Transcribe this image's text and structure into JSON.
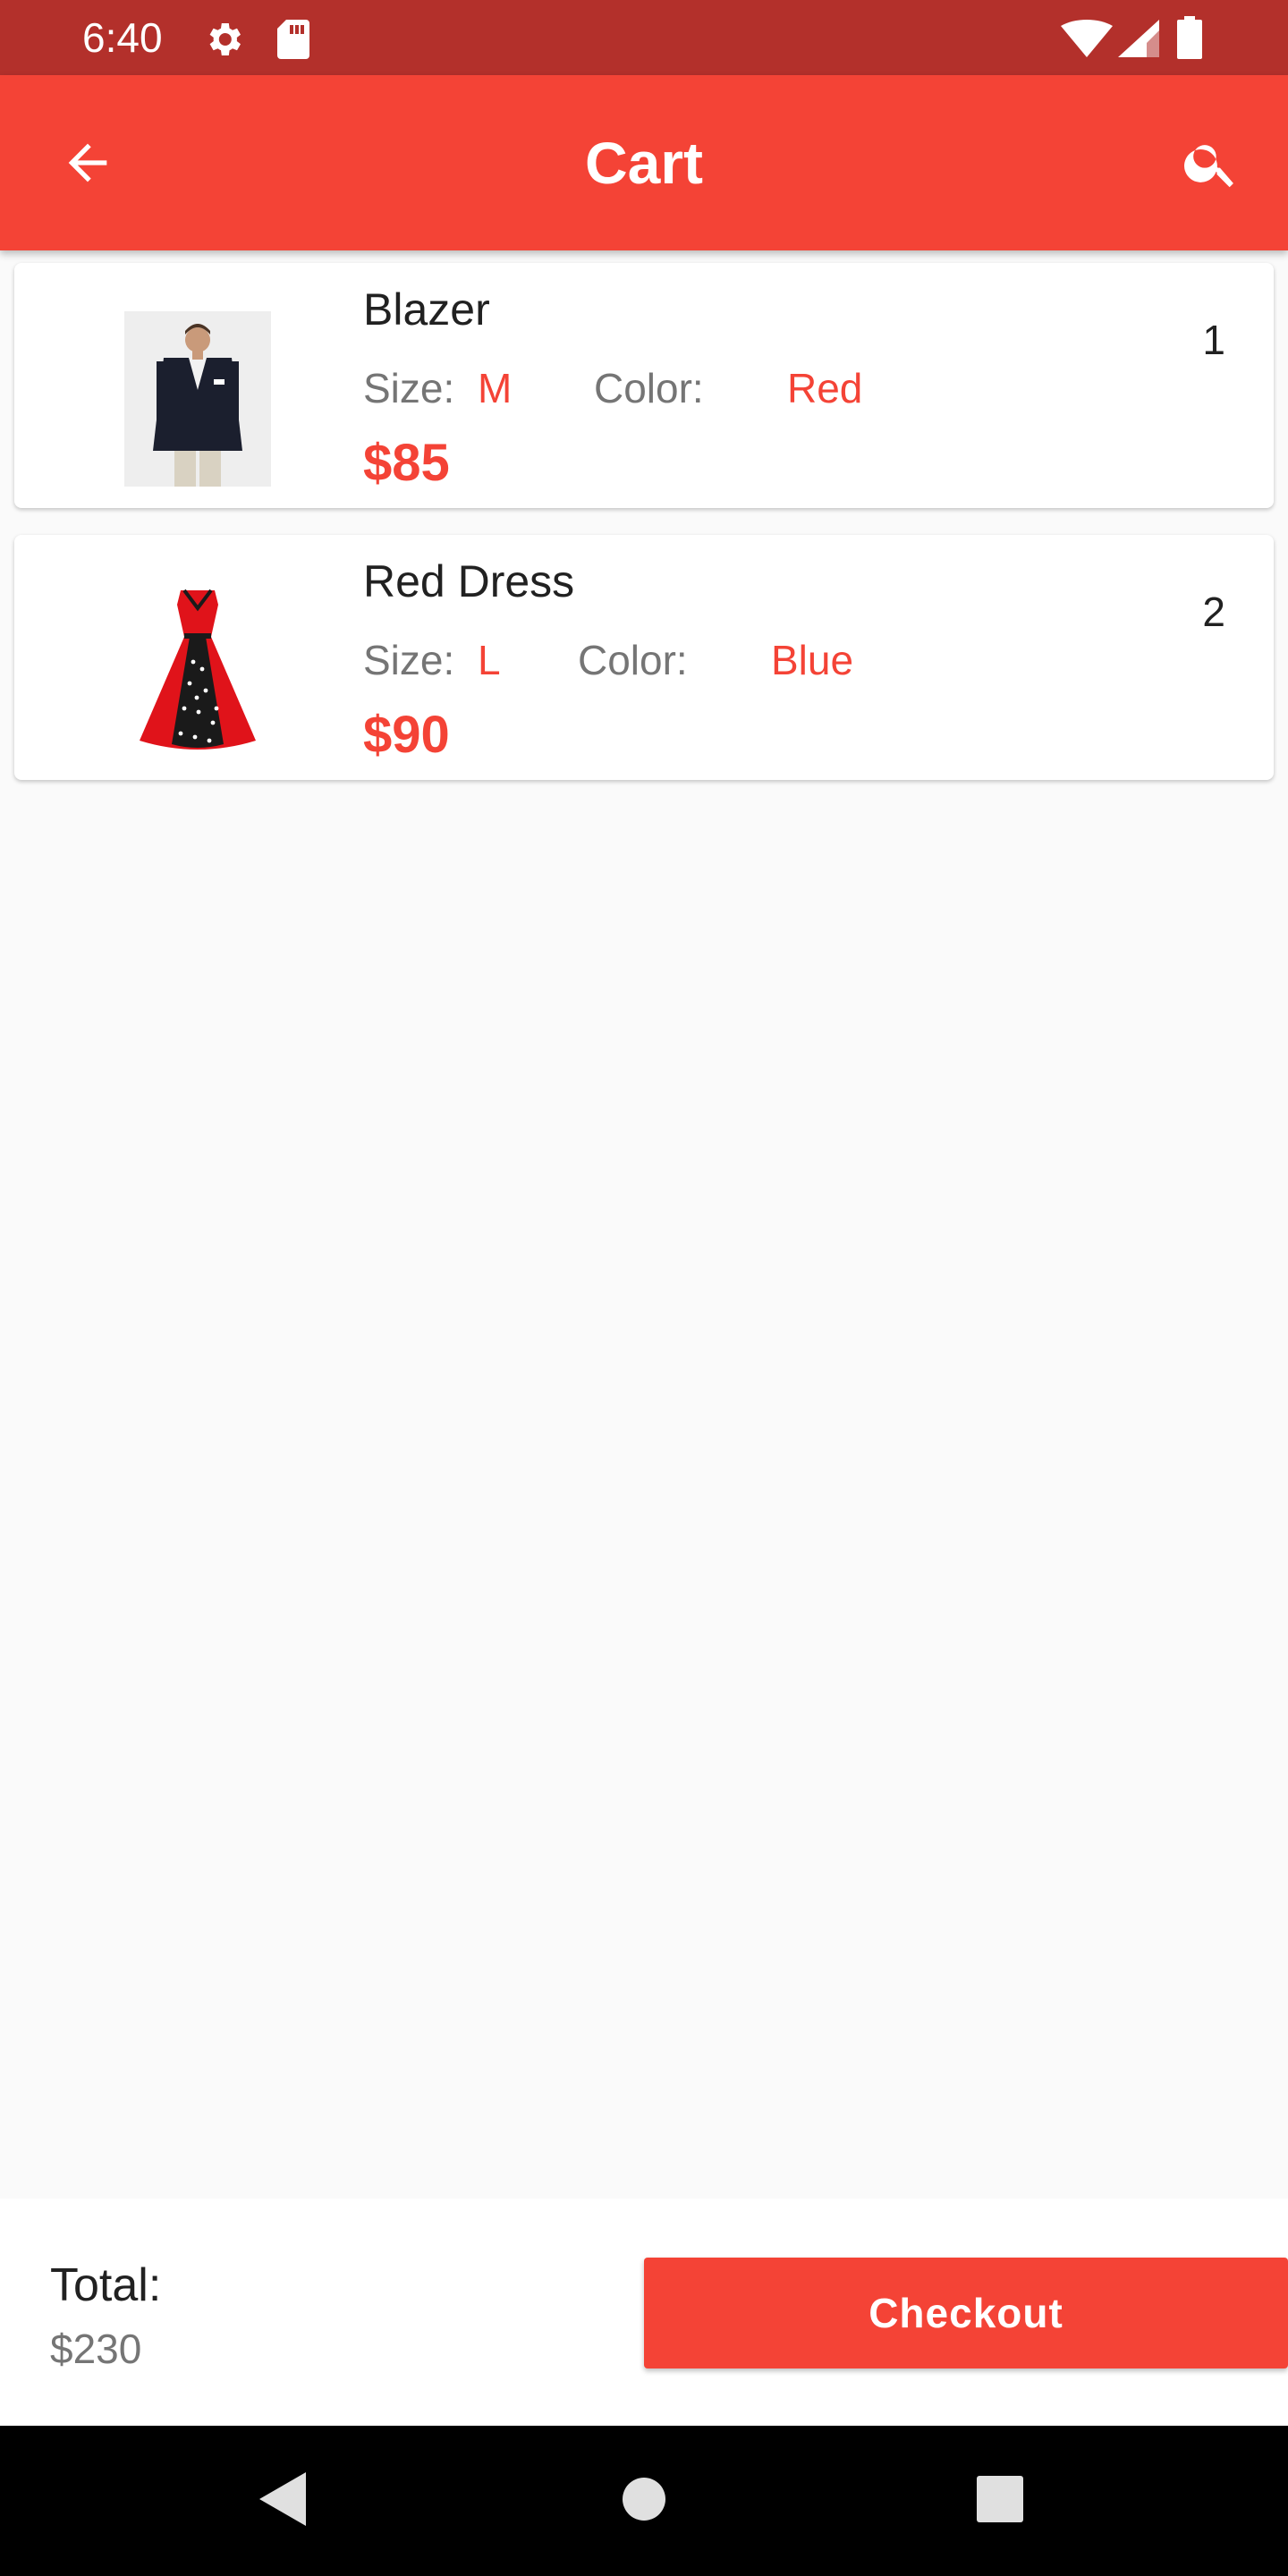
{
  "status_bar": {
    "time": "6:40",
    "icons": [
      "settings-icon",
      "sd-card-icon",
      "wifi-icon",
      "signal-icon",
      "battery-icon"
    ]
  },
  "app_bar": {
    "title": "Cart",
    "back_icon": "arrow-back-icon",
    "search_icon": "search-icon",
    "color": "#f44336",
    "status_color": "#b3302b"
  },
  "cart": {
    "items": [
      {
        "name": "Blazer",
        "size_label": "Size:",
        "size": "M",
        "color_label": "Color:",
        "color": "Red",
        "price": "$85",
        "quantity": "1",
        "image": "blazer-image"
      },
      {
        "name": "Red Dress",
        "size_label": "Size:",
        "size": "L",
        "color_label": "Color:",
        "color": "Blue",
        "price": "$90",
        "quantity": "2",
        "image": "red-dress-image"
      }
    ]
  },
  "footer": {
    "total_label": "Total:",
    "total_value": "$230",
    "checkout_label": "Checkout"
  },
  "nav_bar": {
    "icons": [
      "back-triangle-icon",
      "home-circle-icon",
      "recents-square-icon"
    ]
  },
  "accent_color": "#f44336"
}
